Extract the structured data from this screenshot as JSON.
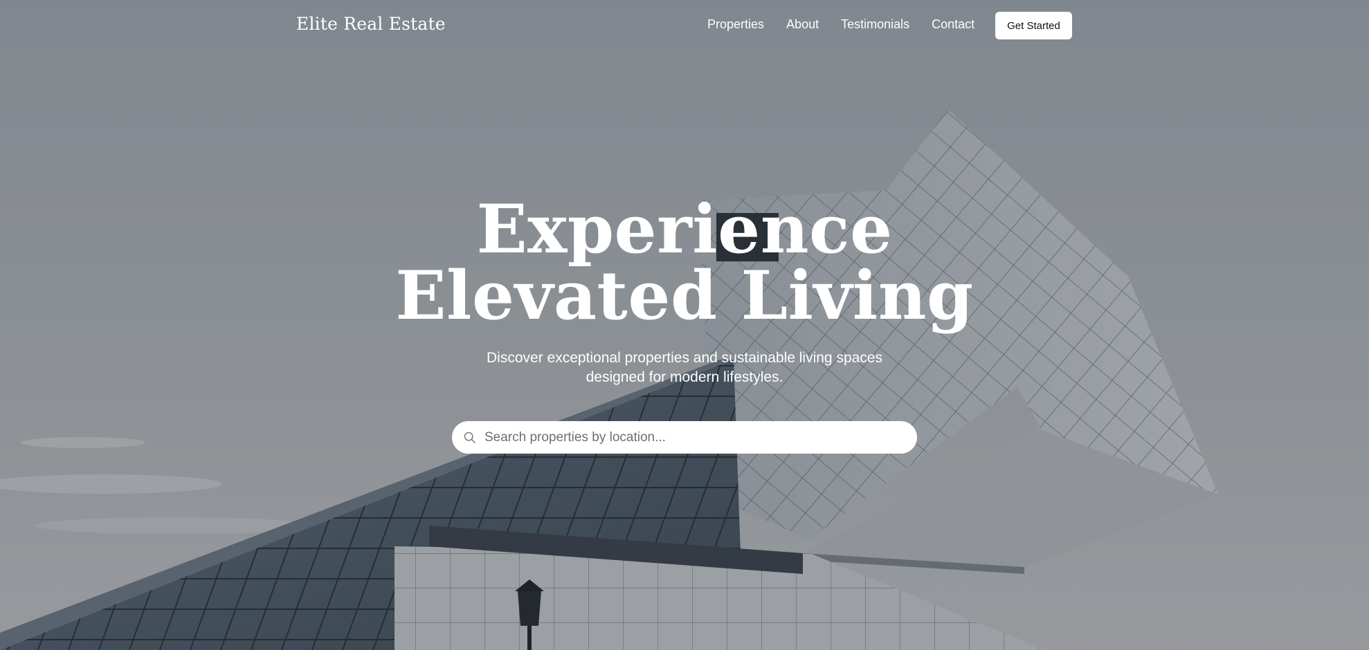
{
  "nav": {
    "brand": "Elite Real Estate",
    "links": [
      {
        "label": "Properties"
      },
      {
        "label": "About"
      },
      {
        "label": "Testimonials"
      },
      {
        "label": "Contact"
      }
    ],
    "cta_label": "Get Started"
  },
  "hero": {
    "headline_line1": "Experience",
    "headline_line2": "Elevated Living",
    "subtitle": "Discover exceptional properties and sustainable living spaces designed for modern lifestyles.",
    "search": {
      "placeholder": "Search properties by location...",
      "value": "",
      "icon": "search-icon"
    },
    "background": "modern-architecture-photo"
  },
  "colors": {
    "text": "#ffffff",
    "button_bg": "#ffffff",
    "button_text": "#111111"
  }
}
